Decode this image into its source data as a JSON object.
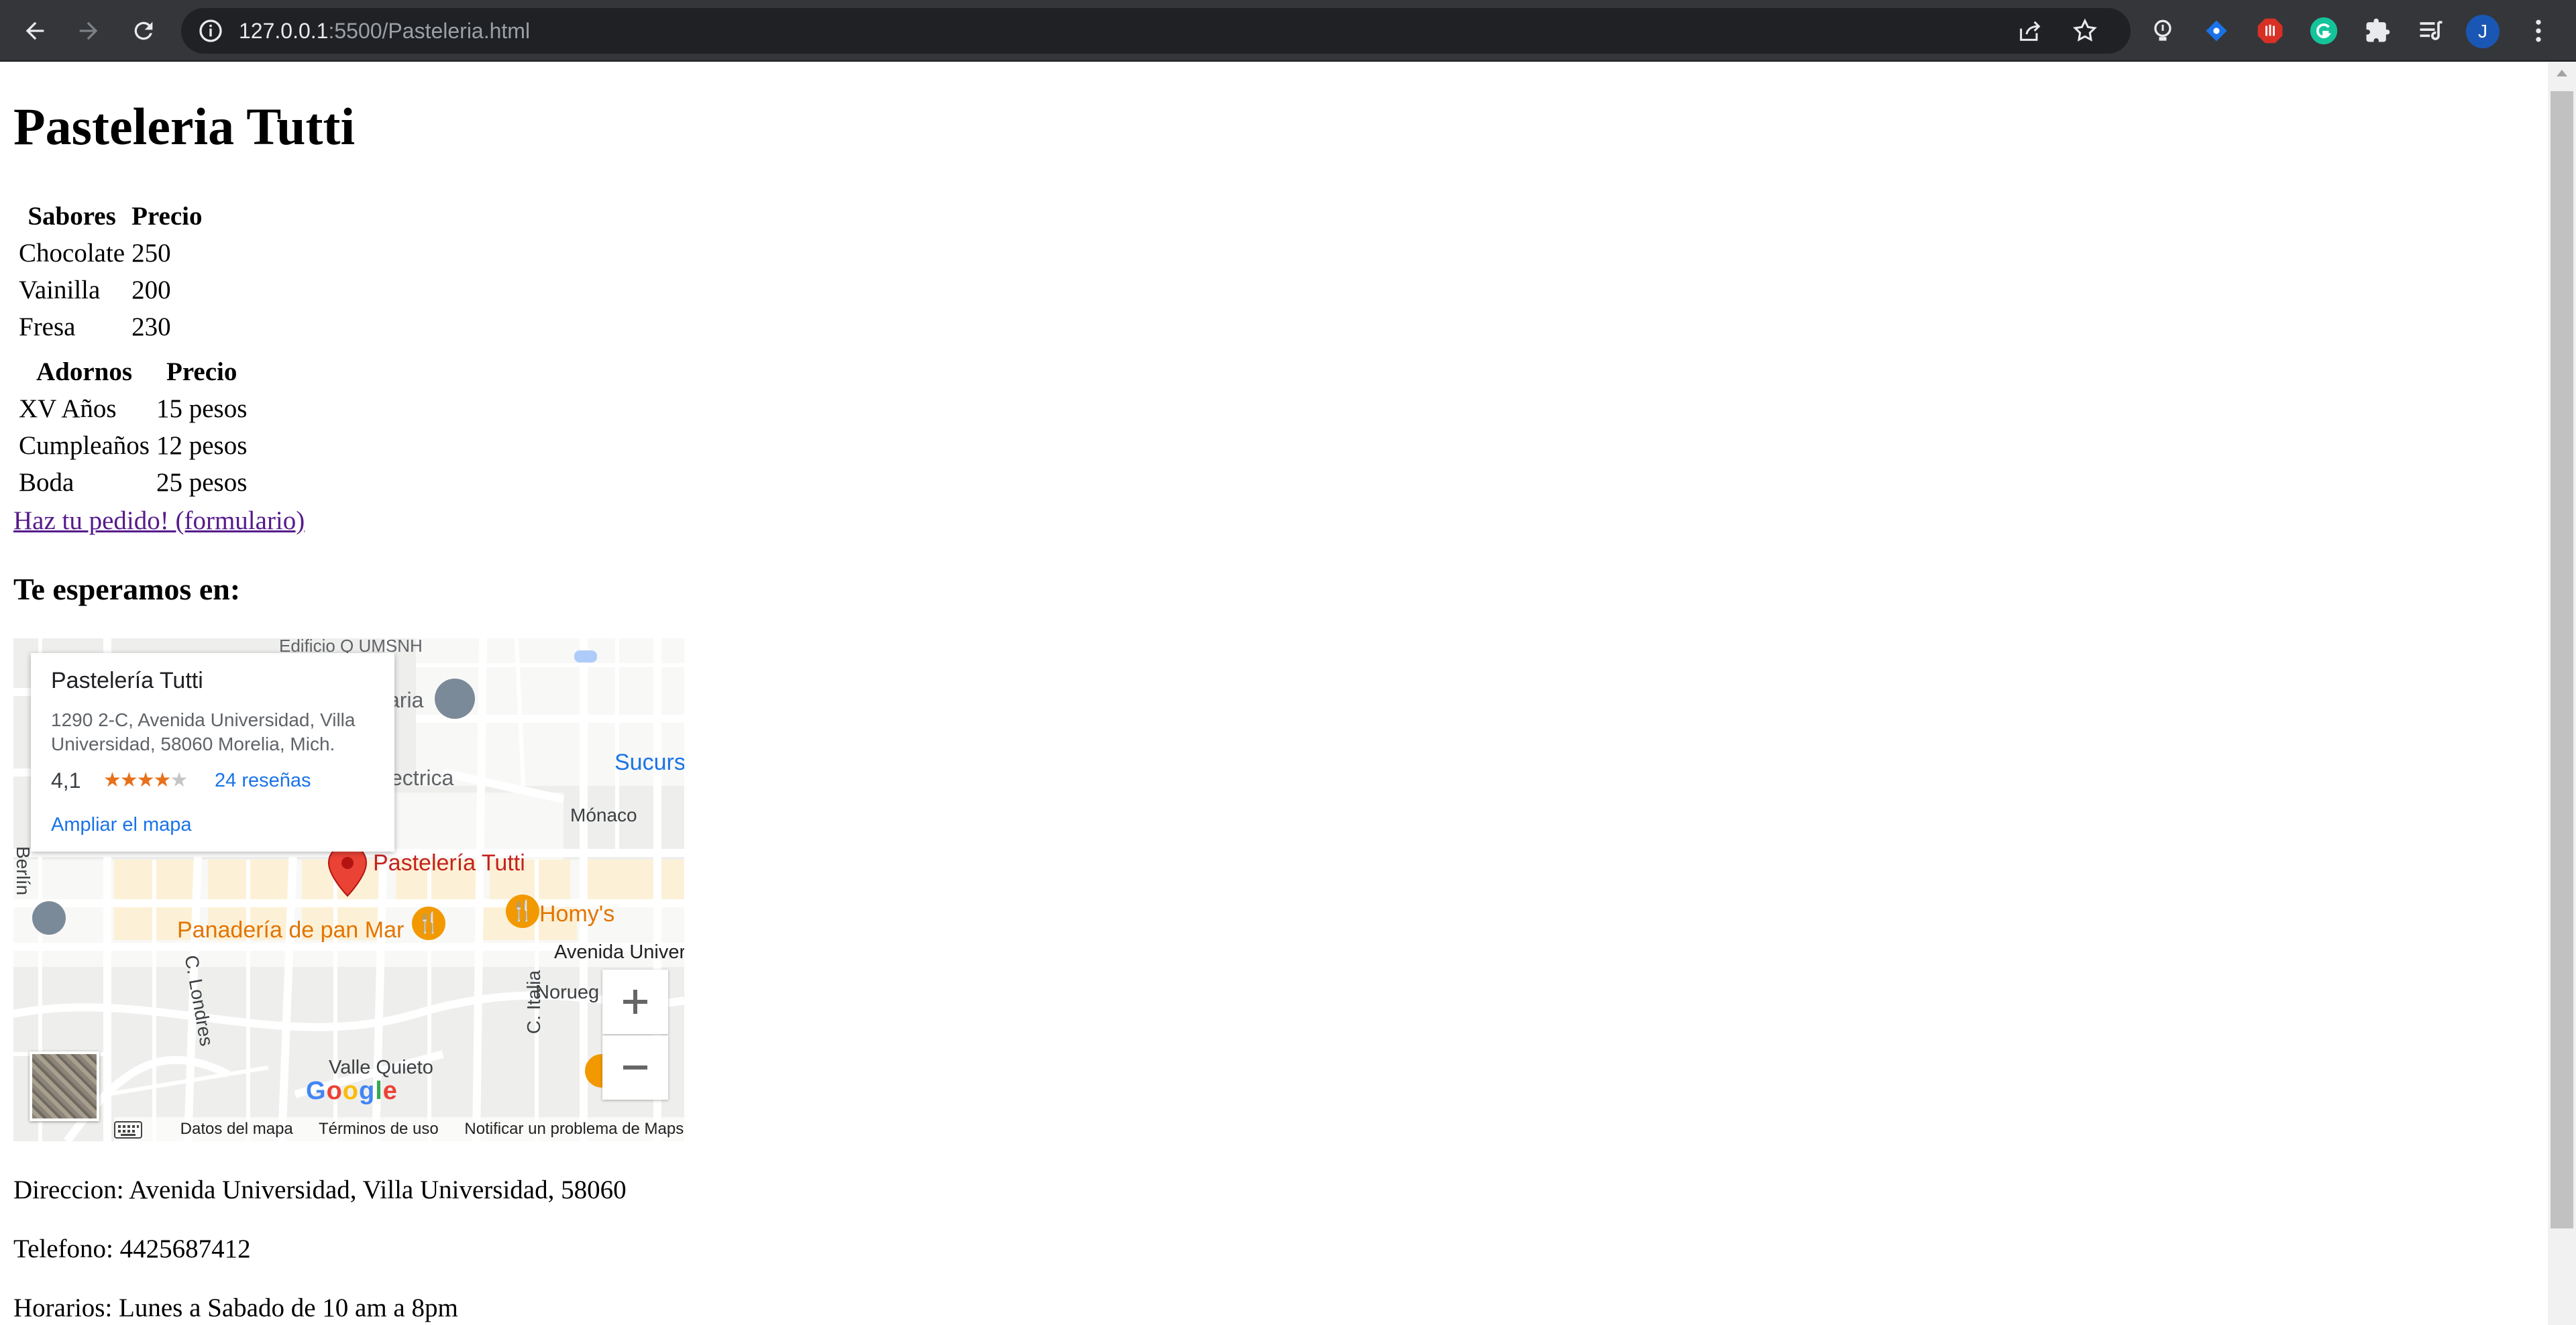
{
  "browser": {
    "url_host": "127.0.0.1",
    "url_path": ":5500/Pasteleria.html",
    "profile_initial": "J"
  },
  "page": {
    "title": "Pasteleria Tutti",
    "sabores_table": {
      "headers": [
        "Sabores",
        "Precio"
      ],
      "rows": [
        [
          "Chocolate",
          "250"
        ],
        [
          "Vainilla",
          "200"
        ],
        [
          "Fresa",
          "230"
        ]
      ]
    },
    "adornos_table": {
      "headers": [
        "Adornos",
        "Precio"
      ],
      "rows": [
        [
          "XV Años",
          "15 pesos"
        ],
        [
          "Cumpleaños",
          "12 pesos"
        ],
        [
          "Boda",
          "25 pesos"
        ]
      ]
    },
    "order_link": "Haz tu pedido! (formulario)",
    "location_heading": "Te esperamos en:",
    "direccion": "Direccion: Avenida Universidad, Villa Universidad, 58060",
    "telefono": "Telefono: 4425687412",
    "horarios": "Horarios: Lunes a Sabado de 10 am a 8pm"
  },
  "map": {
    "card": {
      "title": "Pastelería Tutti",
      "address": "1290 2-C, Avenida Universidad, Villa Universidad, 58060 Morelia, Mich.",
      "rating": "4,1",
      "rating_value": 4.1,
      "reviews": "24 reseñas",
      "enlarge": "Ampliar el mapa"
    },
    "labels": {
      "pin": "Pastelería Tutti",
      "bakery": "Panadería de pan Mar",
      "homys": "Homy's",
      "avenida": "Avenida Univers",
      "monaco": "Mónaco",
      "sucurs": "Sucurs",
      "noruega": "Norueg",
      "valle": "Valle Quieto",
      "londres": "C. Londres",
      "italia": "C. Italia",
      "berlin": "Berlín",
      "ectrica": "ectrica",
      "aria": "aria",
      "edificio": "Edificio Q UMSNH"
    },
    "attribution": [
      "Datos del mapa",
      "Términos de uso",
      "Notificar un problema de Maps"
    ],
    "zoom_in": "+",
    "zoom_out": "−",
    "google": "Google"
  },
  "colors": {
    "chrome_bg": "#35363a",
    "omnibox_bg": "#202124",
    "link_visited": "#551a8b",
    "map_pin": "#ea4335",
    "food_poi": "#f29900",
    "map_link": "#1a73e8"
  }
}
